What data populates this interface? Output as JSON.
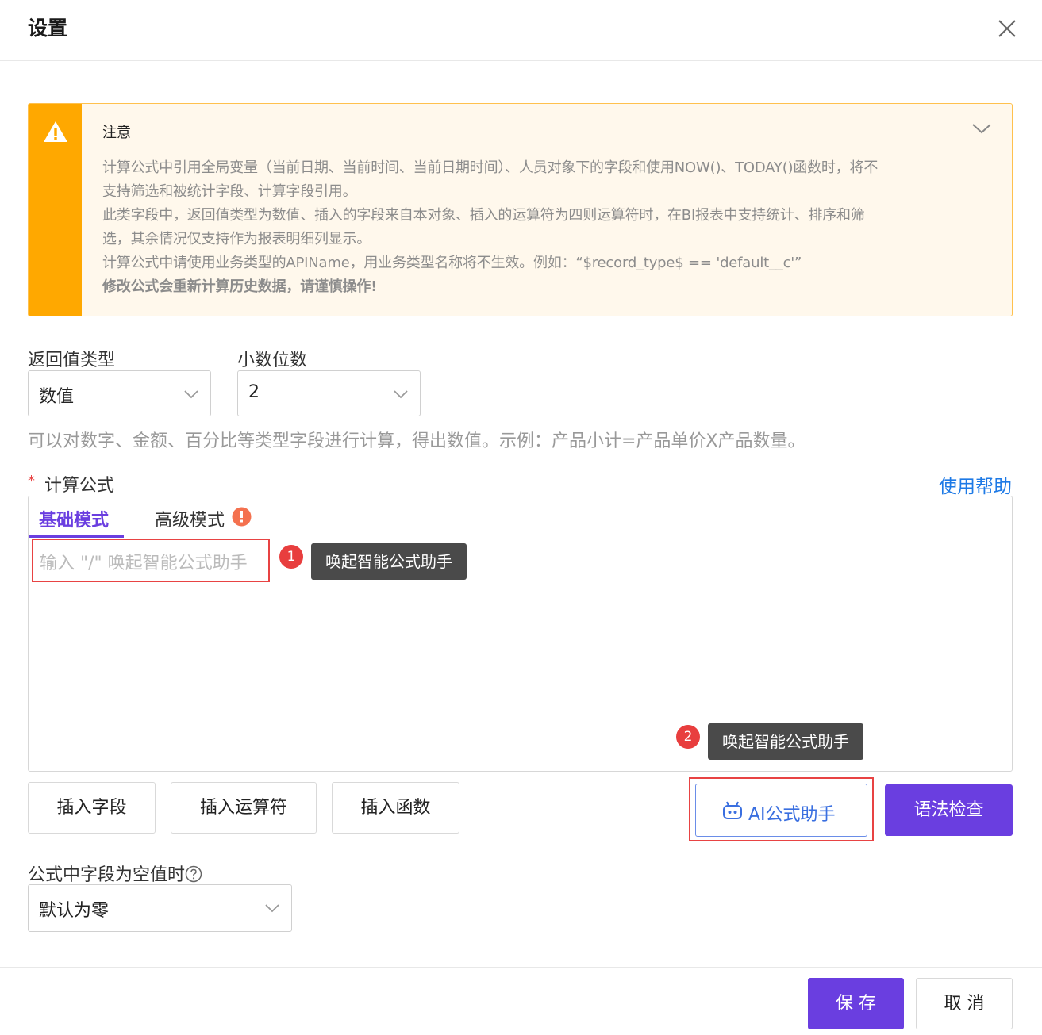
{
  "header": {
    "title": "设置",
    "close_icon": "close-icon"
  },
  "notice": {
    "title": "注意",
    "lines": [
      "计算公式中引用全局变量（当前日期、当前时间、当前日期时间）、人员对象下的字段和使用NOW()、TODAY()函数时，将不",
      "支持筛选和被统计字段、计算字段引用。",
      "此类字段中，返回值类型为数值、插入的字段来自本对象、插入的运算符为四则运算符时，在BI报表中支持统计、排序和筛",
      "选，其余情况仅支持作为报表明细列显示。",
      "计算公式中请使用业务类型的APIName，用业务类型名称将不生效。例如：“$record_type$ == 'default__c'”"
    ],
    "warning_line": "修改公式会重新计算历史数据，请谨慎操作!",
    "accent_color": "#ffa800"
  },
  "return_type": {
    "label": "返回值类型",
    "value": "数值"
  },
  "decimal": {
    "label": "小数位数",
    "value": "2"
  },
  "hint": "可以对数字、金额、百分比等类型字段进行计算，得出数值。示例：产品小计=产品单价X产品数量。",
  "formula": {
    "required_mark": "*",
    "label": "计算公式",
    "help_link": "使用帮助",
    "tabs": [
      {
        "label": "基础模式"
      },
      {
        "label": "高级模式"
      }
    ],
    "placeholder": "输入 \"/\" 唤起智能公式助手"
  },
  "annotations": [
    {
      "badge": "1",
      "tooltip": "唤起智能公式助手"
    },
    {
      "badge": "2",
      "tooltip": "唤起智能公式助手"
    }
  ],
  "toolbar": {
    "insert_field": "插入字段",
    "insert_operator": "插入运算符",
    "insert_function": "插入函数",
    "ai_assistant": "AI公式助手",
    "syntax_check": "语法检查"
  },
  "empty_field": {
    "label": "公式中字段为空值时",
    "value": "默认为零"
  },
  "footer": {
    "save": "保 存",
    "cancel": "取 消"
  },
  "colors": {
    "primary": "#6a3ee0",
    "link": "#1e7ae6",
    "danger": "#e84343"
  }
}
